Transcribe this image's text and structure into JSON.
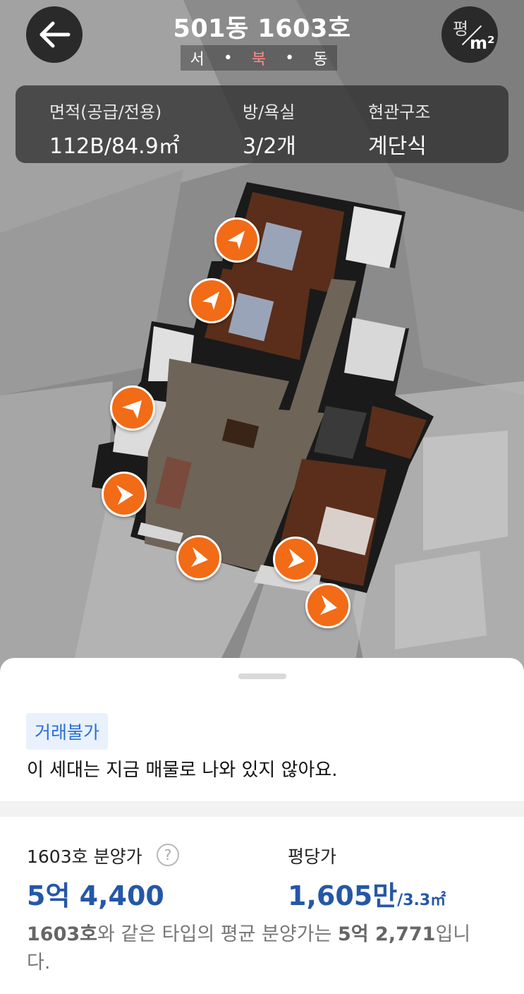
{
  "header": {
    "title": "501동 1603호",
    "compass": {
      "west": "서",
      "north": "북",
      "east": "동"
    },
    "unit_toggle": {
      "pyeong": "평",
      "sqm": "m²"
    }
  },
  "info": {
    "area_label": "면적(공급/전용)",
    "area_value": "112B/84.9㎡",
    "rooms_label": "방/욕실",
    "rooms_value": "3/2개",
    "entrance_label": "현관구조",
    "entrance_value": "계단식"
  },
  "icons": {
    "back": "arrow-left-icon",
    "unit": "unit-toggle-icon",
    "camera": "camera-viewpoint-icon",
    "help": "question-mark-icon"
  },
  "colors": {
    "camera_marker": "#f26b16",
    "price_blue": "#2557a7",
    "badge_text": "#2c6fd6",
    "badge_bg": "#e8f1fc",
    "compass_north": "#ff8a8a"
  },
  "sheet": {
    "badge": "거래불가",
    "notice": "이 세대는 지금 매물로 나와 있지 않아요.",
    "sale_price_label": "1603호 분양가",
    "help_glyph": "?",
    "sale_price_value": "5억 4,400",
    "per_area_label": "평당가",
    "per_area_value": "1,605만",
    "per_area_unit": "/3.3㎡",
    "avg_note": {
      "unit": "1603호",
      "middle": "와 같은 타입의 평균 분양가는 ",
      "price": "5억 2,771",
      "end": "입니다."
    }
  }
}
